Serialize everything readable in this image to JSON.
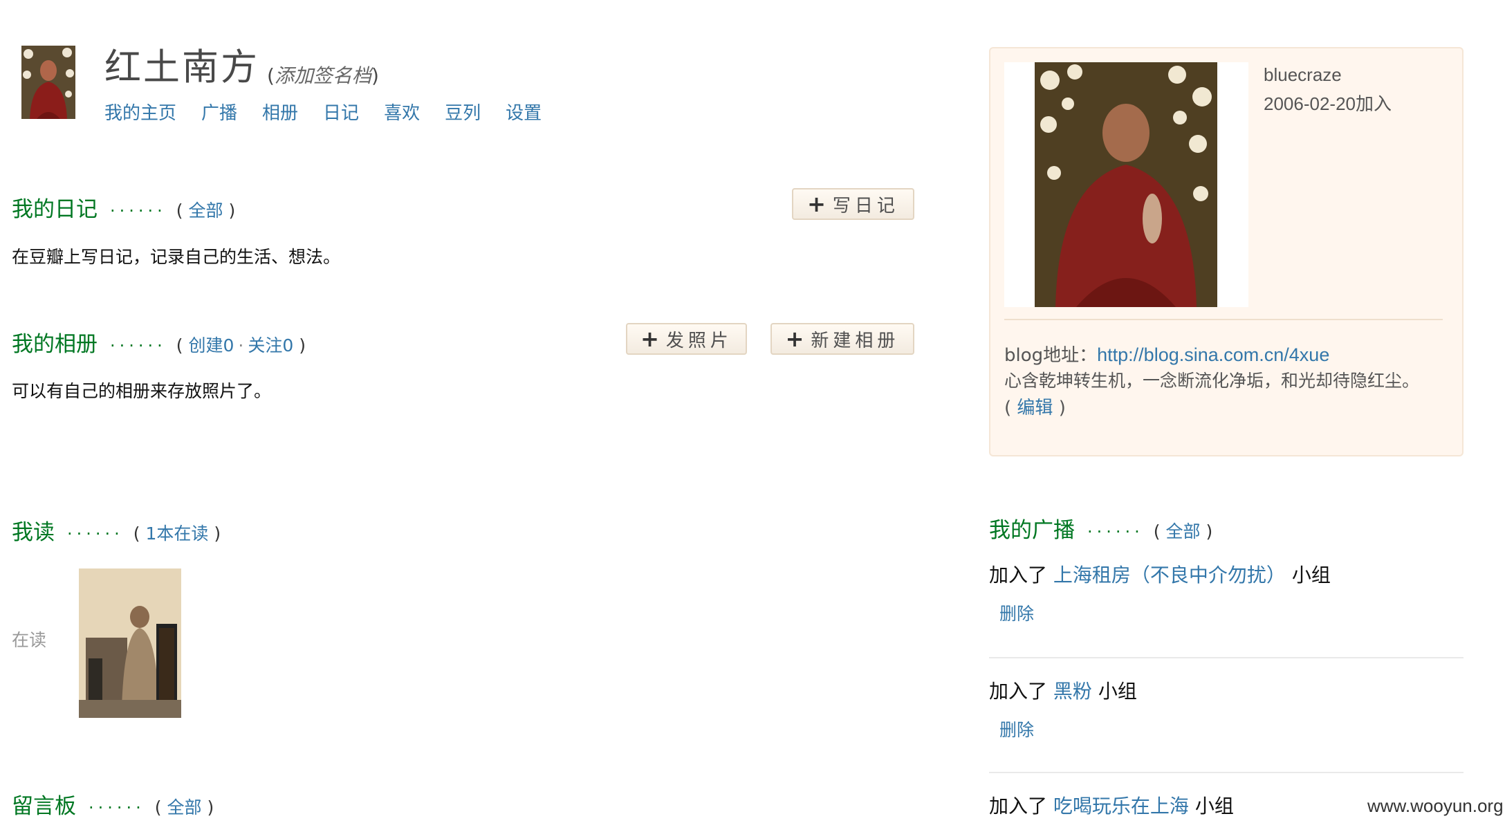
{
  "header": {
    "username": "红土南方",
    "signature_open": "(",
    "signature_text": "添加签名档",
    "signature_close": ")",
    "nav": [
      "我的主页",
      "广播",
      "相册",
      "日记",
      "喜欢",
      "豆列",
      "设置"
    ]
  },
  "diary": {
    "title": "我的日记",
    "dots": "······",
    "all_label": "全部",
    "write_button": "写日记",
    "description": "在豆瓣上写日记，记录自己的生活、想法。"
  },
  "album": {
    "title": "我的相册",
    "dots": "······",
    "created_label": "创建0",
    "follow_label": "关注0",
    "upload_button": "发照片",
    "new_album_button": "新建相册",
    "description": "可以有自己的相册来存放照片了。"
  },
  "reading": {
    "title": "我读",
    "dots": "······",
    "count_label": "1本在读",
    "status_label": "在读"
  },
  "guestbook": {
    "title": "留言板",
    "dots": "······",
    "all_label": "全部"
  },
  "profile": {
    "name": "bluecraze",
    "joined": "2006-02-20加入",
    "blog_label": "blog地址：",
    "blog_url": "http://blog.sina.com.cn/4xue",
    "intro": "心含乾坤转生机，一念断流化净垢，和光却待隐红尘。",
    "edit_label": "编辑"
  },
  "broadcast": {
    "title": "我的广播",
    "dots": "······",
    "all_label": "全部",
    "items": [
      {
        "prefix": "加入了",
        "group": "上海租房（不良中介勿扰）",
        "suffix": "小组",
        "delete": "删除"
      },
      {
        "prefix": "加入了",
        "group": "黑粉",
        "suffix": "小组",
        "delete": "删除"
      },
      {
        "prefix": "加入了",
        "group": "吃喝玩乐在上海",
        "suffix": "小组"
      }
    ]
  },
  "watermark": "www.wooyun.org",
  "colors": {
    "section_green": "#007722",
    "link_blue": "#3377aa",
    "card_bg": "#fff6ee"
  }
}
